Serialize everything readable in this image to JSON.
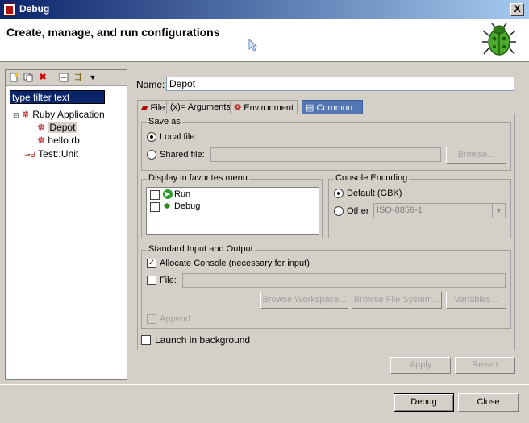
{
  "window": {
    "title": "Debug",
    "close_label": "X"
  },
  "header": {
    "title": "Create, manage, and run configurations"
  },
  "left": {
    "filter_text": "type filter text",
    "tree": [
      {
        "label": "Ruby Application",
        "children": [
          "Depot",
          "hello.rb"
        ]
      },
      {
        "label": "Test::Unit"
      }
    ]
  },
  "config": {
    "name_label": "Name:",
    "name_value": "Depot",
    "tabs": [
      "File",
      "Arguments",
      "Environment",
      "Common"
    ],
    "active_tab": "Common"
  },
  "save_as": {
    "title": "Save as",
    "local_label": "Local file",
    "shared_label": "Shared file:",
    "browse_label": "Browse..."
  },
  "favorites": {
    "title": "Display in favorites menu",
    "items": [
      "Run",
      "Debug"
    ]
  },
  "console_encoding": {
    "title": "Console Encoding",
    "default_label": "Default (GBK)",
    "other_label": "Other",
    "other_value": "ISO-8859-1"
  },
  "stdio": {
    "title": "Standard Input and Output",
    "allocate_label": "Allocate Console (necessary for input)",
    "allocate_checked": true,
    "file_label": "File:",
    "browse_workspace": "Browse Workspace...",
    "browse_fs": "Browse File System...",
    "variables": "Variables...",
    "append_label": "Append"
  },
  "launch_bg_label": "Launch in background",
  "buttons": {
    "apply": "Apply",
    "revert": "Revert",
    "debug": "Debug",
    "close": "Close"
  }
}
